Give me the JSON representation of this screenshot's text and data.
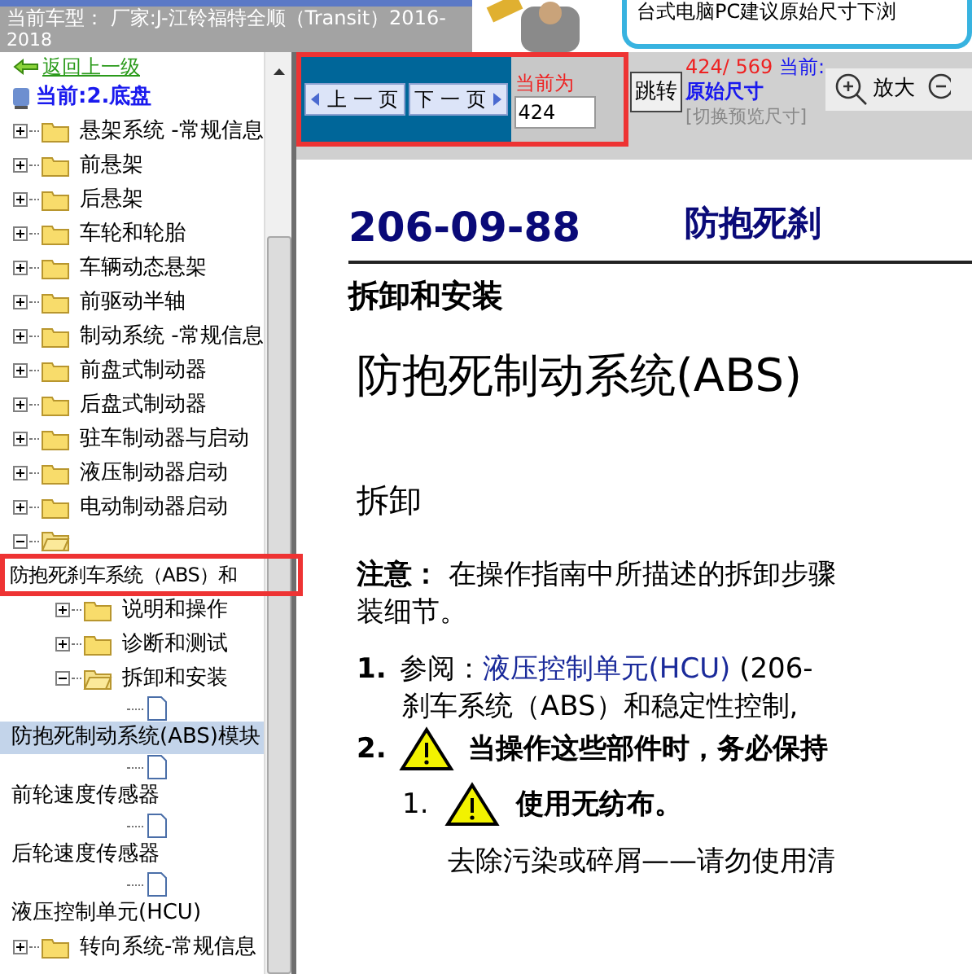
{
  "header": {
    "title": "当前车型： 厂家:J-江铃福特全顺（Transit）2016-",
    "title_cont": "2018",
    "tip": "台式电脑PC建议原始尺寸下浏"
  },
  "sidebar": {
    "back": "返回上一级",
    "current": "当前:2.底盘",
    "items": [
      {
        "kind": "folder",
        "label": "悬架系统 -常规信息",
        "expanded": false,
        "selected": false,
        "outlined": false
      },
      {
        "kind": "folder",
        "label": "前悬架",
        "expanded": false,
        "selected": false,
        "outlined": false
      },
      {
        "kind": "folder",
        "label": "后悬架",
        "expanded": false,
        "selected": false,
        "outlined": false
      },
      {
        "kind": "folder",
        "label": "车轮和轮胎",
        "expanded": false,
        "selected": false,
        "outlined": false
      },
      {
        "kind": "folder",
        "label": "车辆动态悬架",
        "expanded": false,
        "selected": false,
        "outlined": false
      },
      {
        "kind": "folder",
        "label": "前驱动半轴",
        "expanded": false,
        "selected": false,
        "outlined": false
      },
      {
        "kind": "folder",
        "label": "制动系统 -常规信息",
        "expanded": false,
        "selected": false,
        "outlined": false
      },
      {
        "kind": "folder",
        "label": "前盘式制动器",
        "expanded": false,
        "selected": false,
        "outlined": false
      },
      {
        "kind": "folder",
        "label": "后盘式制动器",
        "expanded": false,
        "selected": false,
        "outlined": false
      },
      {
        "kind": "folder",
        "label": "驻车制动器与启动",
        "expanded": false,
        "selected": false,
        "outlined": false
      },
      {
        "kind": "folder",
        "label": "液压制动器启动",
        "expanded": false,
        "selected": false,
        "outlined": false
      },
      {
        "kind": "folder",
        "label": "电动制动器启动",
        "expanded": false,
        "selected": false,
        "outlined": false
      },
      {
        "kind": "folder_wrapped",
        "label": "防抱死刹车系统（ABS）和",
        "expanded": true,
        "selected": false,
        "outlined": true,
        "children": [
          {
            "kind": "folder",
            "label": "说明和操作",
            "expanded": false,
            "selected": false,
            "outlined": false
          },
          {
            "kind": "folder",
            "label": "诊断和测试",
            "expanded": false,
            "selected": false,
            "outlined": false
          },
          {
            "kind": "folder",
            "label": "拆卸和安装",
            "expanded": true,
            "selected": false,
            "outlined": false,
            "children": [
              {
                "kind": "doc",
                "label": "防抱死制动系统(ABS)模块",
                "selected": true,
                "outlined": false
              },
              {
                "kind": "doc",
                "label": "前轮速度传感器",
                "selected": false,
                "outlined": false
              },
              {
                "kind": "doc",
                "label": "后轮速度传感器",
                "selected": false,
                "outlined": false
              },
              {
                "kind": "doc",
                "label": "液压控制单元(HCU)",
                "selected": false,
                "outlined": false
              }
            ]
          }
        ]
      },
      {
        "kind": "folder",
        "label": "转向系统-常规信息",
        "expanded": false,
        "selected": false,
        "outlined": false
      }
    ]
  },
  "toolbar": {
    "prev": "上 一 页",
    "next": "下 一 页",
    "current_label": "当前为",
    "page_input": "424",
    "jump": "跳转",
    "page_count": "424/ 569",
    "current": "当前:",
    "size": "原始尺寸",
    "switch": "[切换预览尺寸]",
    "zoom_in": "放大"
  },
  "document": {
    "code": "206-09-88",
    "header_right": "防抱死刹",
    "section": "拆卸和安装",
    "title": "防抱死制动系统(ABS)",
    "subtitle": "拆卸",
    "note": "**注意：** 在操作指南中所描述的拆卸步骤",
    "note_cont": "装细节。",
    "steps": [
      {
        "kind": "reference",
        "number": "1.",
        "text": "参阅：",
        "link": "液压控制单元(HCU)",
        "after": " (206-",
        "cont": "刹车系统（ABS）和稳定性控制,"
      },
      {
        "kind": "warning",
        "number": "2.",
        "text": "当操作这些部件时，务必保持"
      }
    ],
    "substeps": [
      {
        "kind": "warning",
        "number": "1.",
        "text": "使用无纺布。",
        "detail": "去除污染或碎屑——请勿使用清"
      }
    ]
  }
}
